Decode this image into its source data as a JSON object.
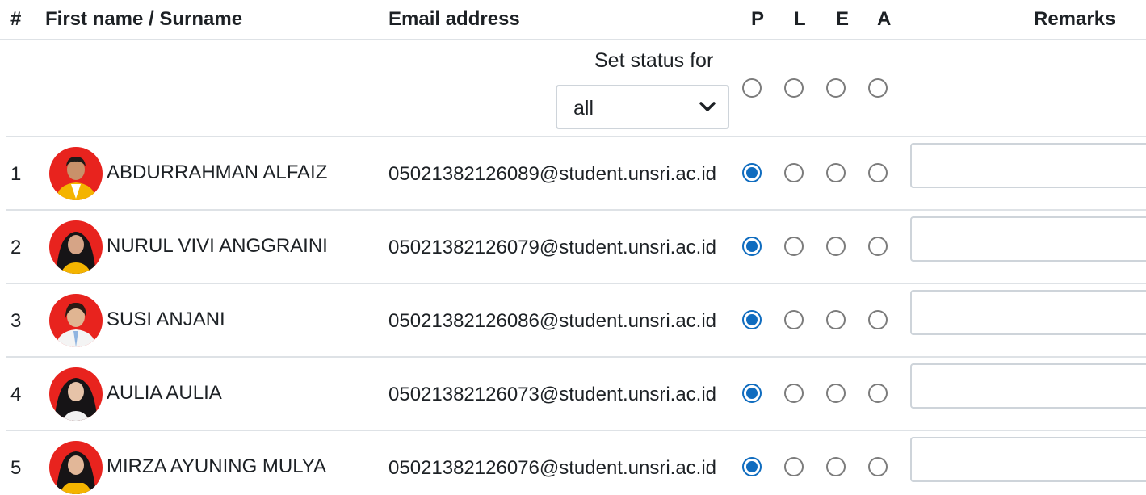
{
  "header": {
    "num": "#",
    "name": "First name / Surname",
    "email": "Email address",
    "p": "P",
    "l": "L",
    "e": "E",
    "a": "A",
    "remarks": "Remarks"
  },
  "set_status": {
    "label": "Set status for",
    "selected": "all"
  },
  "students": [
    {
      "num": "1",
      "name": "ABDURRAHMAN ALFAIZ",
      "email": "05021382126089@student.unsri.ac.id",
      "status": "P",
      "remarks": ""
    },
    {
      "num": "2",
      "name": "NURUL VIVI ANGGRAINI",
      "email": "05021382126079@student.unsri.ac.id",
      "status": "P",
      "remarks": ""
    },
    {
      "num": "3",
      "name": "SUSI ANJANI",
      "email": "05021382126086@student.unsri.ac.id",
      "status": "P",
      "remarks": ""
    },
    {
      "num": "4",
      "name": "AULIA AULIA",
      "email": "05021382126073@student.unsri.ac.id",
      "status": "P",
      "remarks": ""
    },
    {
      "num": "5",
      "name": "MIRZA AYUNING MULYA",
      "email": "05021382126076@student.unsri.ac.id",
      "status": "P",
      "remarks": ""
    }
  ],
  "colors": {
    "accent": "#0f6cbf",
    "border": "#dee2e6",
    "avatar_bg": "#e8231e"
  }
}
